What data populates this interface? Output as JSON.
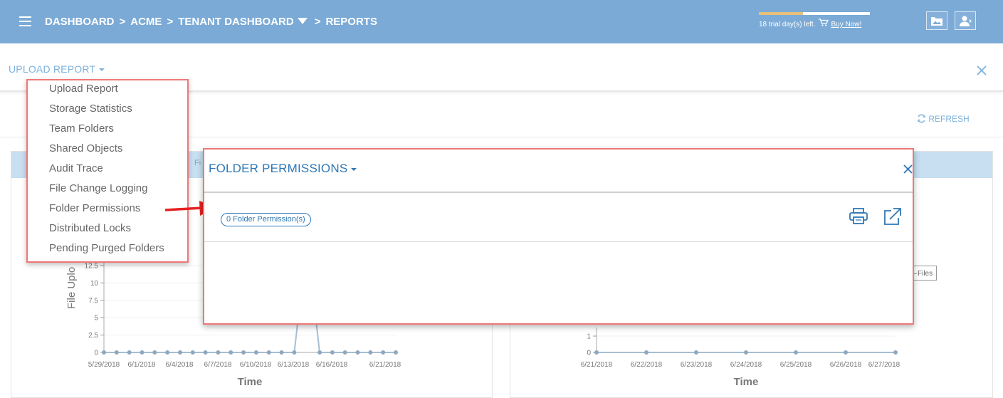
{
  "header": {
    "breadcrumb": [
      "DASHBOARD",
      "ACME",
      "TENANT DASHBOARD",
      "REPORTS"
    ],
    "separator": ">",
    "trial_text": "18 trial day(s) left.",
    "trial_progress": 0.4,
    "buy_now": "Buy Now!"
  },
  "subbar": {
    "title": "UPLOAD REPORT"
  },
  "refresh_label": "REFRESH",
  "panel_head_text": "Fi",
  "dropdown": {
    "items": [
      "Upload Report",
      "Storage Statistics",
      "Team Folders",
      "Shared Objects",
      "Audit Trace",
      "File Change Logging",
      "Folder Permissions",
      "Distributed Locks",
      "Pending Purged Folders"
    ]
  },
  "modal": {
    "title": "FOLDER PERMISSIONS",
    "count_badge": "0 Folder Permission(s)"
  },
  "legend_files": "Files",
  "colors": {
    "header_bg": "#7baad6",
    "accent": "#2f77b5",
    "highlight": "#f07777",
    "line": "#a8bed2"
  },
  "chart_data": [
    {
      "type": "line",
      "ylabel": "File Uplo",
      "xlabel": "Time",
      "yticks": [
        "0",
        "2.5",
        "5",
        "7.5",
        "10",
        "12.5"
      ],
      "xticks": [
        "5/29/2018",
        "6/1/2018",
        "6/4/2018",
        "6/7/2018",
        "6/10/2018",
        "6/13/2018",
        "6/16/2018",
        "6/21/2018"
      ],
      "series": [
        {
          "values": [
            0,
            0,
            0,
            0,
            0,
            0,
            0,
            0,
            0,
            0,
            0,
            0,
            0,
            0,
            0,
            0,
            16,
            0,
            0,
            0,
            0,
            0,
            0,
            0
          ]
        }
      ]
    },
    {
      "type": "line",
      "xlabel": "Time",
      "yticks": [
        "0",
        "1"
      ],
      "xticks": [
        "6/21/2018",
        "6/22/2018",
        "6/23/2018",
        "6/24/2018",
        "6/25/2018",
        "6/26/2018",
        "6/27/2018"
      ],
      "series": [
        {
          "name": "Files",
          "values": [
            0,
            0,
            0,
            0,
            0,
            0,
            0
          ]
        }
      ]
    }
  ]
}
